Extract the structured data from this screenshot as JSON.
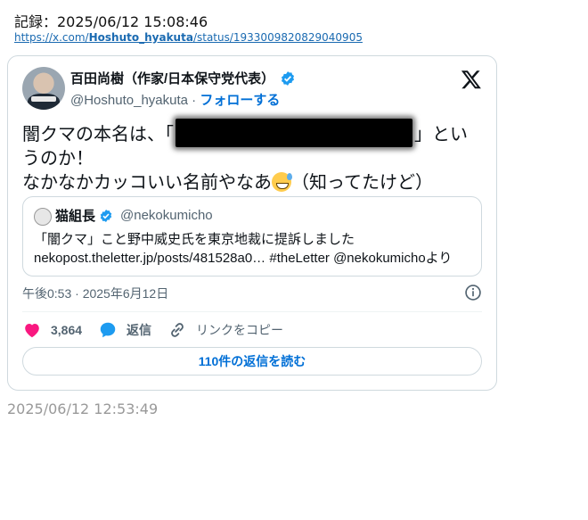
{
  "header": {
    "record_label": "記録：2025/06/12 15:08:46",
    "link_prefix": "https://x.com/",
    "link_user": "Hoshuto_hyakuta",
    "link_suffix": "/status/1933009820829040905"
  },
  "tweet": {
    "display_name": "百田尚樹（作家/日本保守党代表）",
    "handle": "@Hoshuto_hyakuta",
    "separator": " · ",
    "follow_label": "フォローする",
    "text_line1_a": "闇クマの本名は、「",
    "text_line1_b": "」とい",
    "text_line2": "うのか！",
    "text_line3_a": "なかなかカッコいい名前やなあ",
    "text_line3_b": "（知ってたけど）",
    "emoji": "sweat-smile-emoji",
    "timestamp": "午後0:53 · 2025年6月12日"
  },
  "quote": {
    "name": "猫組長",
    "handle": "@nekokumicho",
    "line1": "「闇クマ」こと野中威史氏を東京地裁に提訴しました",
    "line2": "nekopost.theletter.jp/posts/481528a0… #theLetter @nekokumichoより"
  },
  "actions": {
    "like_count": "3,864",
    "reply_label": "返信",
    "copy_link_label": "リンクをコピー",
    "read_replies_label": "110件の返信を読む"
  },
  "footer": {
    "capture_time": "2025/06/12 12:53:49"
  },
  "colors": {
    "accent": "#006fd6",
    "like": "#f91880",
    "reply": "#1d9bf0",
    "verified": "#1d9bf0",
    "border": "#cfd9de"
  }
}
